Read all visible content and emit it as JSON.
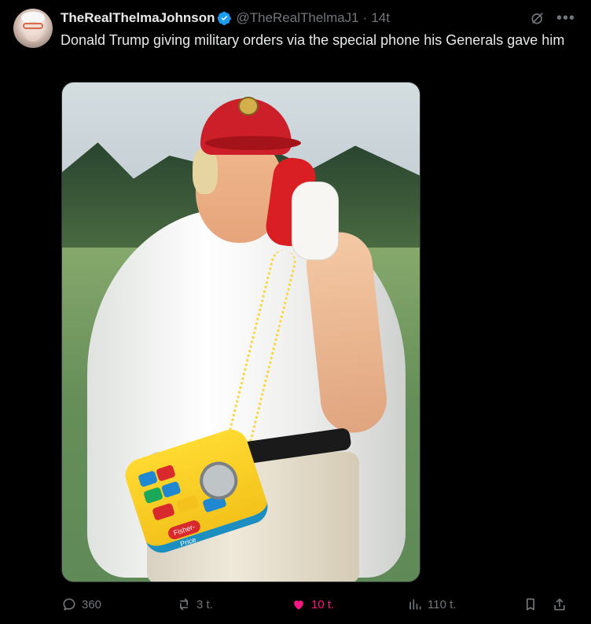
{
  "tweet": {
    "display_name": "TheRealThelmaJohnson",
    "handle": "@TheRealThelmaJ1",
    "separator": "·",
    "time": "14t",
    "text": "Donald Trump giving military orders via the special phone his Generals gave him"
  },
  "media": {
    "phone_brand_label": "Fisher-Price"
  },
  "actions": {
    "replies": "360",
    "reposts": "3 t.",
    "likes": "10 t.",
    "views": "110 t."
  },
  "icons": {
    "verified": "verified-badge-icon",
    "grok": "grok-icon",
    "more": "more-icon",
    "reply": "reply-icon",
    "repost": "repost-icon",
    "like": "heart-icon",
    "views": "views-icon",
    "bookmark": "bookmark-icon",
    "share": "share-icon"
  },
  "colors": {
    "background": "#000000",
    "text": "#e7e9ea",
    "secondary": "#71767b",
    "verified": "#1d9bf0",
    "like_active": "#f91880"
  }
}
